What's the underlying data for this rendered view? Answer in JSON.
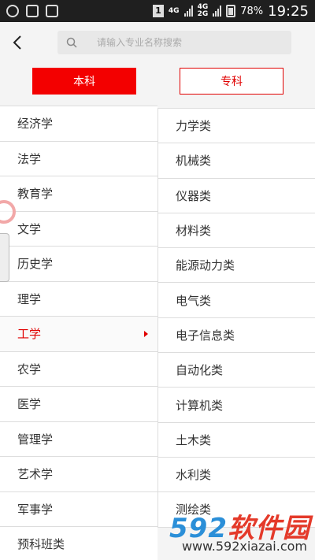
{
  "status_bar": {
    "sim_label": "1",
    "net_top": "4G",
    "net_bottom": "4G",
    "net_bottom2": "2G",
    "battery": "78%",
    "time": "19:25"
  },
  "header": {
    "search_placeholder": "请输入专业名称搜索"
  },
  "tabs": [
    {
      "label": "本科"
    },
    {
      "label": "专科"
    }
  ],
  "categories": [
    {
      "label": "经济学"
    },
    {
      "label": "法学"
    },
    {
      "label": "教育学"
    },
    {
      "label": "文学"
    },
    {
      "label": "历史学"
    },
    {
      "label": "理学"
    },
    {
      "label": "工学"
    },
    {
      "label": "农学"
    },
    {
      "label": "医学"
    },
    {
      "label": "管理学"
    },
    {
      "label": "艺术学"
    },
    {
      "label": "军事学"
    },
    {
      "label": "预科班类"
    }
  ],
  "subcategories": [
    {
      "label": "力学类"
    },
    {
      "label": "机械类"
    },
    {
      "label": "仪器类"
    },
    {
      "label": "材料类"
    },
    {
      "label": "能源动力类"
    },
    {
      "label": "电气类"
    },
    {
      "label": "电子信息类"
    },
    {
      "label": "自动化类"
    },
    {
      "label": "计算机类"
    },
    {
      "label": "土木类"
    },
    {
      "label": "水利类"
    },
    {
      "label": "测绘类"
    }
  ],
  "watermark": {
    "logo_num": "592",
    "logo_text": "软件园",
    "url": "www.592xiazai.com"
  },
  "colors": {
    "accent": "#f30000",
    "watermark_blue": "#2b8fd8",
    "watermark_red": "#e43a2a"
  }
}
